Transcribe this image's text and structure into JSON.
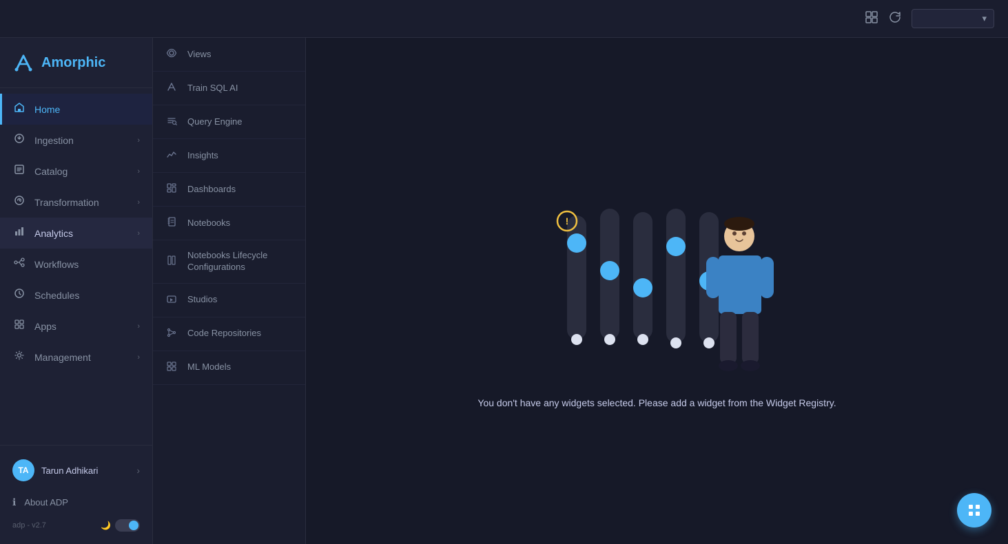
{
  "app": {
    "name": "Amorphic",
    "version": "adp - v2.7"
  },
  "topbar": {
    "layout_icon": "⊞",
    "refresh_icon": "↻",
    "dropdown_label": ""
  },
  "sidebar": {
    "nav_items": [
      {
        "id": "home",
        "label": "Home",
        "icon": "🏠",
        "active": true,
        "has_chevron": false
      },
      {
        "id": "ingestion",
        "label": "Ingestion",
        "icon": "⬇",
        "active": false,
        "has_chevron": true
      },
      {
        "id": "catalog",
        "label": "Catalog",
        "icon": "📋",
        "active": false,
        "has_chevron": true
      },
      {
        "id": "transformation",
        "label": "Transformation",
        "icon": "⚙",
        "active": false,
        "has_chevron": true
      },
      {
        "id": "analytics",
        "label": "Analytics",
        "icon": "📊",
        "active": false,
        "has_chevron": true,
        "expanded": true
      },
      {
        "id": "workflows",
        "label": "Workflows",
        "icon": "🔄",
        "active": false,
        "has_chevron": false
      },
      {
        "id": "schedules",
        "label": "Schedules",
        "icon": "🕐",
        "active": false,
        "has_chevron": false
      },
      {
        "id": "apps",
        "label": "Apps",
        "icon": "⊞",
        "active": false,
        "has_chevron": true
      },
      {
        "id": "management",
        "label": "Management",
        "icon": "🛠",
        "active": false,
        "has_chevron": true
      }
    ],
    "user": {
      "initials": "TA",
      "name": "Tarun Adhikari"
    },
    "about_label": "About ADP",
    "version": "adp - v2.7"
  },
  "sub_sidebar": {
    "items": [
      {
        "id": "views",
        "label": "Views",
        "icon": "views"
      },
      {
        "id": "train-sql-ai",
        "label": "Train SQL AI",
        "icon": "ai"
      },
      {
        "id": "query-engine",
        "label": "Query Engine",
        "icon": "query"
      },
      {
        "id": "insights",
        "label": "Insights",
        "icon": "insights"
      },
      {
        "id": "dashboards",
        "label": "Dashboards",
        "icon": "dashboards"
      },
      {
        "id": "notebooks",
        "label": "Notebooks",
        "icon": "notebooks"
      },
      {
        "id": "notebooks-lifecycle",
        "label": "Notebooks Lifecycle Configurations",
        "icon": "lifecycle"
      },
      {
        "id": "studios",
        "label": "Studios",
        "icon": "studios"
      },
      {
        "id": "code-repositories",
        "label": "Code Repositories",
        "icon": "code"
      },
      {
        "id": "ml-models",
        "label": "ML Models",
        "icon": "ml"
      }
    ]
  },
  "content": {
    "empty_message": "You don't have any widgets selected. Please add a widget from the Widget Registry."
  }
}
